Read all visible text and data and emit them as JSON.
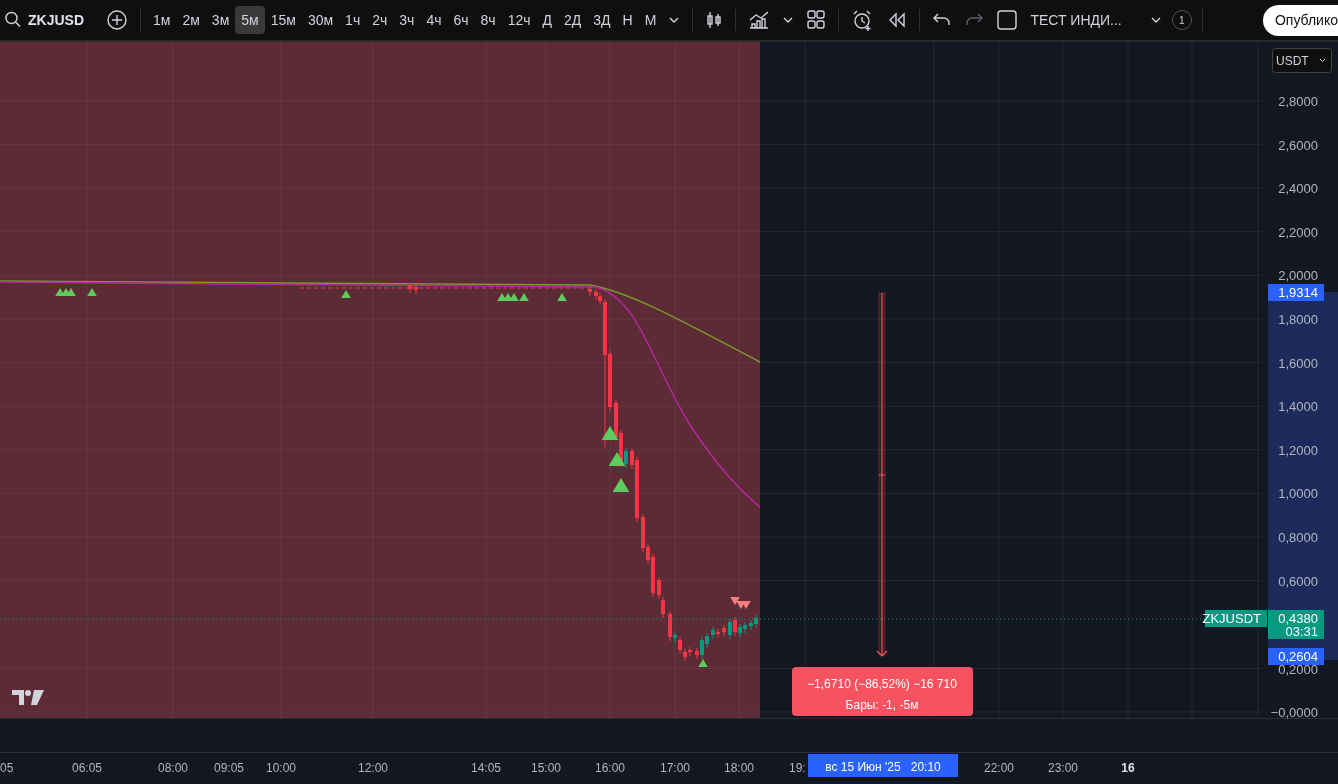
{
  "toolbar": {
    "symbol": "ZKJUSD",
    "intervals": [
      {
        "label": "1м",
        "selected": false
      },
      {
        "label": "2м",
        "selected": false
      },
      {
        "label": "3м",
        "selected": false
      },
      {
        "label": "5м",
        "selected": true
      },
      {
        "label": "15м",
        "selected": false
      },
      {
        "label": "30м",
        "selected": false
      },
      {
        "label": "1ч",
        "selected": false
      },
      {
        "label": "2ч",
        "selected": false
      },
      {
        "label": "3ч",
        "selected": false
      },
      {
        "label": "4ч",
        "selected": false
      },
      {
        "label": "6ч",
        "selected": false
      },
      {
        "label": "8ч",
        "selected": false
      },
      {
        "label": "12ч",
        "selected": false
      },
      {
        "label": "Д",
        "selected": false
      },
      {
        "label": "2Д",
        "selected": false
      },
      {
        "label": "3Д",
        "selected": false
      },
      {
        "label": "Н",
        "selected": false
      },
      {
        "label": "М",
        "selected": false
      }
    ],
    "undo": {
      "disabled": false
    },
    "redo": {
      "disabled": true
    },
    "indicator_template": "ТЕСТ ИНДИ...",
    "alerts_count": "1",
    "publish": "Опублико"
  },
  "chart": {
    "currency": "USDT",
    "price_ticks": [
      "2,8000",
      "2,6000",
      "2,4000",
      "2,2000",
      "2,0000",
      "1,8000",
      "1,6000",
      "1,4000",
      "1,2000",
      "1,0000",
      "0,8000",
      "0,6000",
      "0,2000",
      "−0,0000"
    ],
    "range_high": "1,9314",
    "range_low": "0,2604",
    "last_price": {
      "symbol": "ZKJUSDT",
      "price": "0,4380",
      "countdown": "03:31"
    },
    "measure": {
      "change": "−1,6710 (−86,52%) −16 710",
      "bars": "Бары: -1, -5м"
    },
    "time_ticks": [
      {
        "label": "05",
        "bold": false
      },
      {
        "label": "06:05",
        "bold": false
      },
      {
        "label": "08:00",
        "bold": false
      },
      {
        "label": "09:05",
        "bold": false
      },
      {
        "label": "10:00",
        "bold": false
      },
      {
        "label": "12:00",
        "bold": false
      },
      {
        "label": "14:05",
        "bold": false
      },
      {
        "label": "15:00",
        "bold": false
      },
      {
        "label": "16:00",
        "bold": false
      },
      {
        "label": "17:00",
        "bold": false
      },
      {
        "label": "18:00",
        "bold": false
      },
      {
        "label": "19:",
        "bold": false
      },
      {
        "label": "22:00",
        "bold": false
      },
      {
        "label": "23:00",
        "bold": false
      },
      {
        "label": "16",
        "bold": true
      }
    ],
    "crosshair_time": "вс 15 Июн '25   20:10"
  }
}
